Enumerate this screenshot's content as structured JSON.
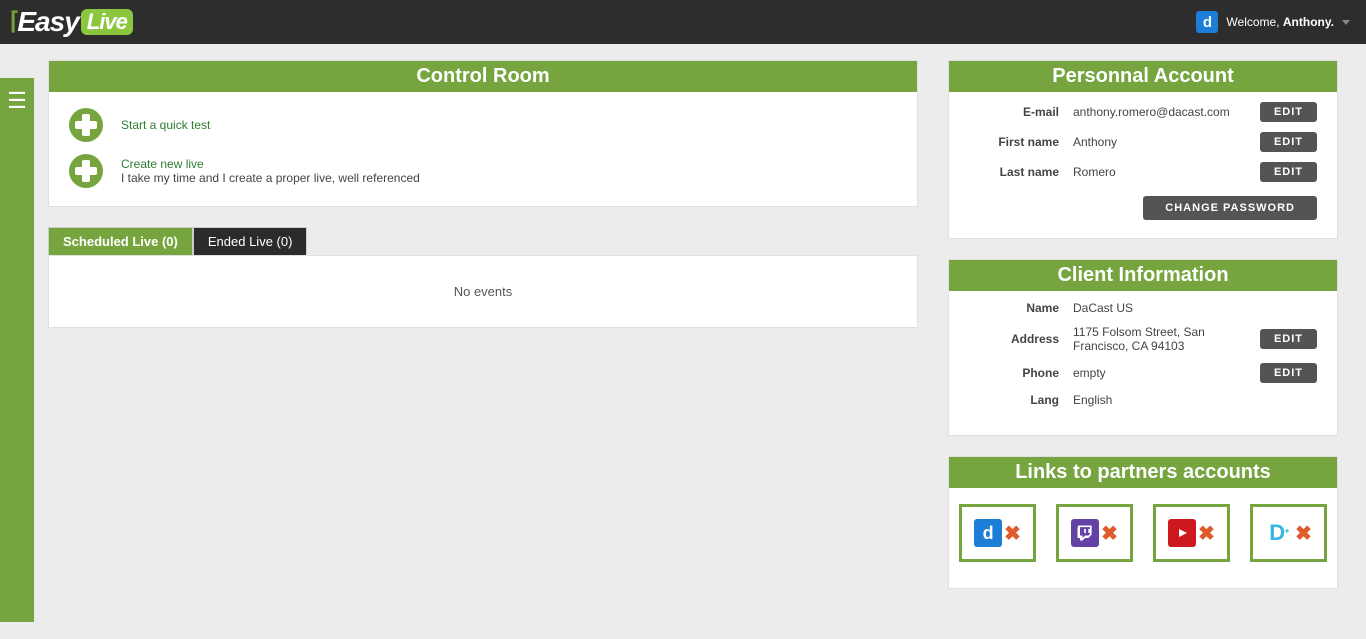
{
  "brand": {
    "easy": "Easy",
    "live": "Live"
  },
  "user": {
    "welcome_prefix": "Welcome, ",
    "name": "Anthony.",
    "avatar_letter": "d"
  },
  "control": {
    "title": "Control Room",
    "quick_test": "Start a quick test",
    "create_live_title": "Create new live",
    "create_live_sub": "I take my time and I create a proper live, well referenced",
    "tab_scheduled": "Scheduled Live (0)",
    "tab_ended": "Ended Live (0)",
    "no_events": "No events"
  },
  "account": {
    "title": "Personnal Account",
    "rows": {
      "email_label": "E-mail",
      "email_value": "anthony.romero@dacast.com",
      "first_label": "First name",
      "first_value": "Anthony",
      "last_label": "Last name",
      "last_value": "Romero"
    },
    "edit": "EDIT",
    "change_pw": "CHANGE PASSWORD"
  },
  "client": {
    "title": "Client Information",
    "rows": {
      "name_label": "Name",
      "name_value": "DaCast US",
      "addr_label": "Address",
      "addr_value": "1175 Folsom Street, San Francisco, CA 94103",
      "phone_label": "Phone",
      "phone_value": "empty",
      "lang_label": "Lang",
      "lang_value": "English"
    },
    "edit": "EDIT"
  },
  "partners": {
    "title": "Links to partners accounts",
    "x": "✖",
    "d": "d",
    "daily": "D*"
  }
}
